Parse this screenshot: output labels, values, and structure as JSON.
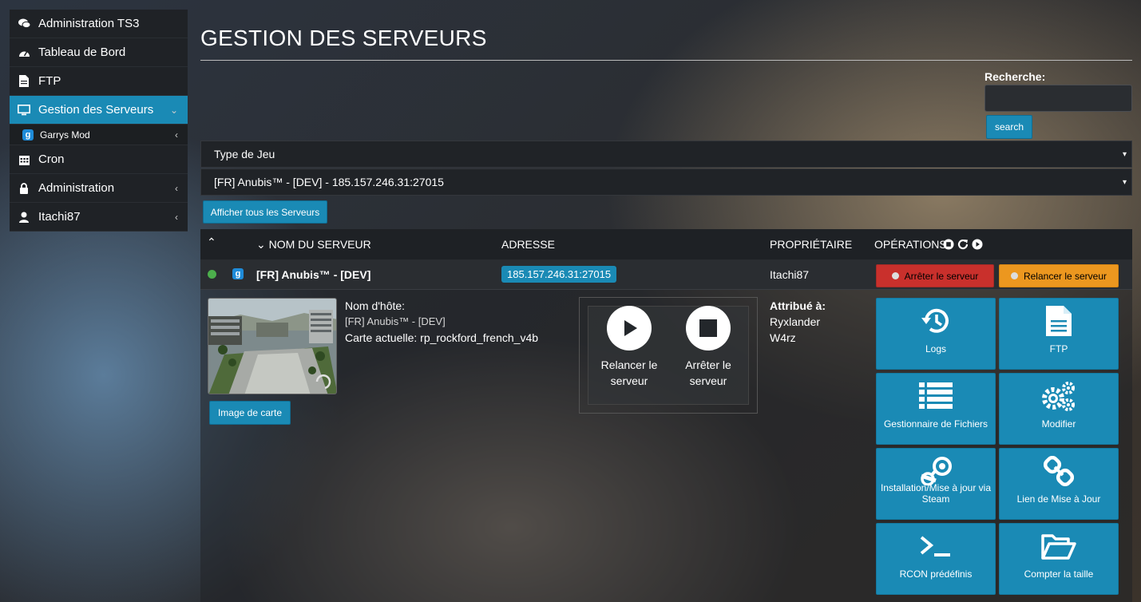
{
  "sidebar": {
    "items": [
      {
        "label": "Administration TS3",
        "icon": "comments-icon"
      },
      {
        "label": "Tableau de Bord",
        "icon": "dashboard-icon"
      },
      {
        "label": "FTP",
        "icon": "file-icon"
      },
      {
        "label": "Gestion des Serveurs",
        "icon": "monitor-icon",
        "arrow": "⌄"
      },
      {
        "label": "Garrys Mod",
        "icon": "g-icon",
        "arrow": "‹"
      },
      {
        "label": "Cron",
        "icon": "calendar-icon"
      },
      {
        "label": "Administration",
        "icon": "lock-icon",
        "arrow": "‹"
      },
      {
        "label": "Itachi87",
        "icon": "user-icon",
        "arrow": "‹"
      }
    ]
  },
  "header": {
    "title": "GESTION DES SERVEURS"
  },
  "search": {
    "label": "Recherche:",
    "button": "search",
    "value": ""
  },
  "filters": {
    "game_type": "Type de Jeu",
    "server": "[FR] Anubis™ - [DEV] - 185.157.246.31:27015",
    "caret": "▾",
    "show_all": "Afficher tous les Serveurs"
  },
  "table": {
    "columns": {
      "sort_up": "⌃",
      "name": "⌄ NOM DU SERVEUR",
      "address": "ADRESSE",
      "owner": "PROPRIÉTAIRE",
      "operations": "OPÉRATIONS"
    },
    "row": {
      "badge": "g",
      "name": "[FR] Anubis™ - [DEV]",
      "address": "185.157.246.31:27015",
      "owner": "Itachi87",
      "stop": "Arrêter le serveur",
      "restart": "Relancer le serveur"
    }
  },
  "details": {
    "map_button": "Image de carte",
    "hostname_label": "Nom d'hôte:",
    "hostname": "[FR] Anubis™ - [DEV]",
    "map_line": "Carte actuelle: rp_rockford_french_v4b",
    "restart_line1": "Relancer le",
    "restart_line2": "serveur",
    "stop_line1": "Arrêter le",
    "stop_line2": "serveur",
    "assigned_label": "Attribué à:",
    "assigned": [
      "Ryxlander",
      "W4rz"
    ]
  },
  "operations": [
    {
      "label": "Logs",
      "icon": "history-icon"
    },
    {
      "label": "FTP",
      "icon": "file-text-icon"
    },
    {
      "label": "Gestionnaire de Fichiers",
      "icon": "list-icon"
    },
    {
      "label": "Modifier",
      "icon": "gears-icon"
    },
    {
      "label": "Installation/Mise à jour via Steam",
      "icon": "steam-icon"
    },
    {
      "label": "Lien de Mise à Jour",
      "icon": "link-icon"
    },
    {
      "label": "RCON prédéfinis",
      "icon": "terminal-icon"
    },
    {
      "label": "Compter la taille",
      "icon": "folder-open-icon"
    }
  ],
  "colors": {
    "accent": "#1a8ab5",
    "danger": "#c9302c",
    "warning": "#ec971f",
    "online": "#4cae4c"
  }
}
